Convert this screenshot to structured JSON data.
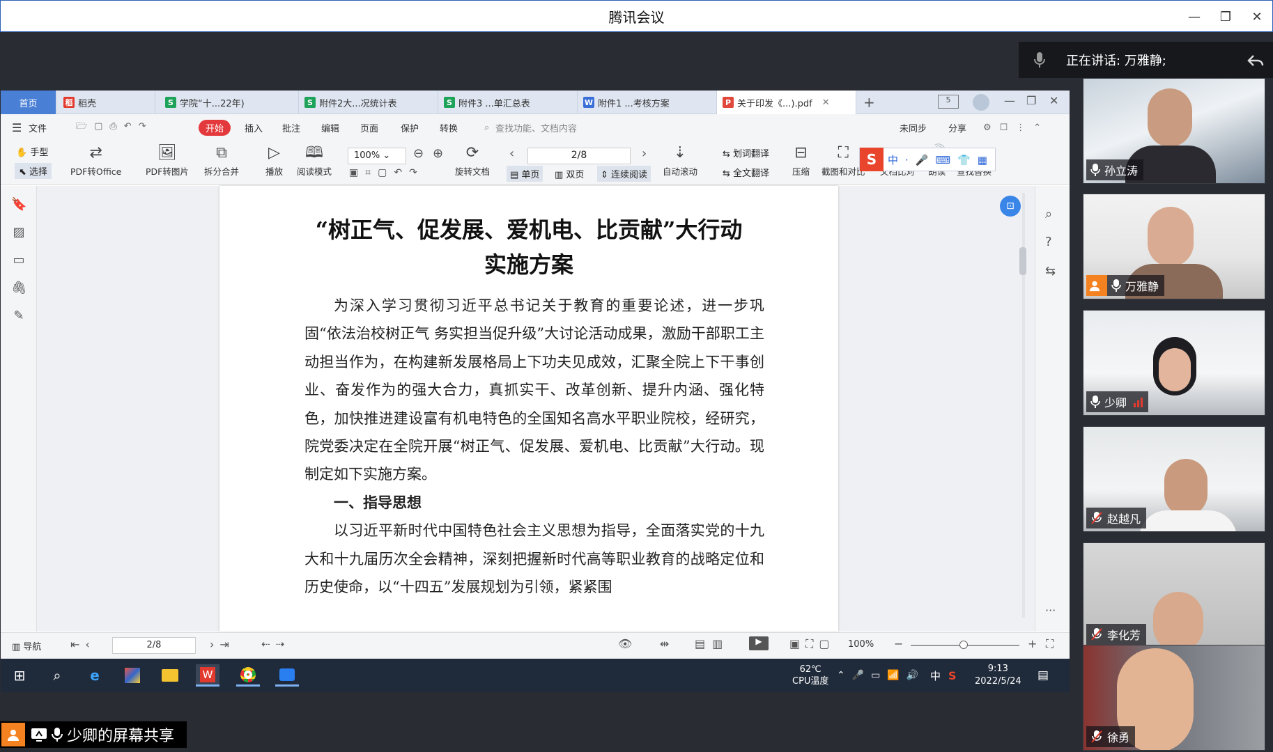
{
  "window": {
    "title": "腾讯会议"
  },
  "speaking": {
    "text": "正在讲话: 万雅静;"
  },
  "wps": {
    "tabs": [
      {
        "label": "首页"
      },
      {
        "label": "稻壳"
      },
      {
        "label": "学院“十...22年)"
      },
      {
        "label": "附件2大...况统计表"
      },
      {
        "label": "附件3 ...单汇总表"
      },
      {
        "label": "附件1 ...考核方案"
      },
      {
        "label": "关于印发《...).pdf"
      }
    ],
    "menu": {
      "file": "文件",
      "start": "开始",
      "insert": "插入",
      "annotate": "批注",
      "edit": "编辑",
      "page": "页面",
      "protect": "保护",
      "convert": "转换",
      "search_placeholder": "查找功能、文档内容",
      "unsynced": "未同步",
      "share": "分享"
    },
    "ribbon": {
      "hand": "手型",
      "select": "选择",
      "pdf_to_office": "PDF转Office",
      "pdf_to_image": "PDF转图片",
      "split_merge": "拆分合并",
      "play": "播放",
      "read_mode": "阅读模式",
      "zoom": "100%",
      "rotate": "旋转文档",
      "page_indicator": "2/8",
      "single": "单页",
      "double": "双页",
      "continuous": "连续阅读",
      "auto_scroll": "自动滚动",
      "word_translate": "划词翻译",
      "full_translate": "全文翻译",
      "compress": "压缩",
      "screenshot": "截图和对比",
      "doc_compare": "文档比对",
      "read_aloud": "朗读",
      "find_replace": "查找替换"
    },
    "document": {
      "title_line1": "“树正气、促发展、爱机电、比贡献”大行动",
      "title_line2": "实施方案",
      "para1": "为深入学习贯彻习近平总书记关于教育的重要论述，进一步巩固“依法治校树正气 务实担当促升级”大讨论活动成果，激励干部职工主动担当作为，在构建新发展格局上下功夫见成效，汇聚全院上下干事创业、奋发作为的强大合力，真抓实干、改革创新、提升内涵、强化特色，加快推进建设富有机电特色的全国知名高水平职业院校，经研究，院党委决定在全院开展“树正气、促发展、爱机电、比贡献”大行动。现制定如下实施方案。",
      "heading1": "一、指导思想",
      "para2": "以习近平新时代中国特色社会主义思想为指导，全面落实党的十九大和十九届历次全会精神，深刻把握新时代高等职业教育的战略定位和历史使命，以“十四五”发展规划为引领，紧紧围"
    },
    "status": {
      "nav": "导航",
      "page": "2/8",
      "zoom": "100%"
    }
  },
  "taskbar": {
    "temp": "62℃",
    "temp_label": "CPU温度",
    "ime": "中",
    "time": "9:13",
    "date": "2022/5/24"
  },
  "share_label": "少卿的屏幕共享",
  "participants": [
    {
      "name": "孙立涛",
      "muted": false
    },
    {
      "name": "万雅静",
      "muted": false
    },
    {
      "name": "少卿",
      "muted": false
    },
    {
      "name": "赵越凡",
      "muted": true
    },
    {
      "name": "李化芳",
      "muted": true
    },
    {
      "name": "徐勇",
      "muted": true
    }
  ]
}
